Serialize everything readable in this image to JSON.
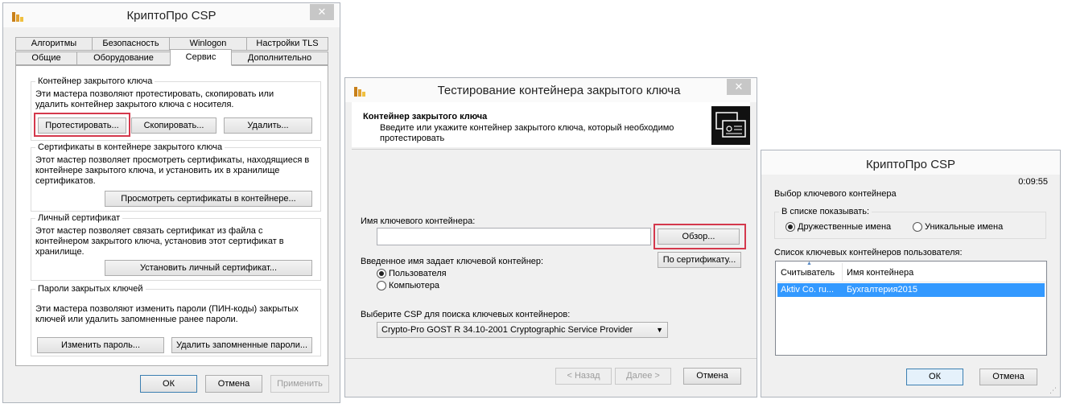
{
  "window1": {
    "title": "КриптоПро CSP",
    "close": "✕",
    "tabs_row1": [
      "Алгоритмы",
      "Безопасность",
      "Winlogon",
      "Настройки TLS"
    ],
    "tabs_row2": [
      "Общие",
      "Оборудование",
      "Сервис",
      "Дополнительно"
    ],
    "group_container": {
      "title": "Контейнер закрытого ключа",
      "desc": "Эти мастера позволяют протестировать, скопировать или удалить контейнер закрытого ключа с носителя.",
      "test_btn": "Протестировать...",
      "copy_btn": "Скопировать...",
      "delete_btn": "Удалить..."
    },
    "group_certs": {
      "title": "Сертификаты в контейнере закрытого ключа",
      "desc": "Этот мастер позволяет просмотреть сертификаты, находящиеся в контейнере закрытого ключа, и установить их в хранилище сертификатов.",
      "view_btn": "Просмотреть сертификаты в контейнере..."
    },
    "group_personal": {
      "title": "Личный сертификат",
      "desc": "Этот мастер позволяет связать сертификат из файла с контейнером закрытого ключа, установив этот сертификат в хранилище.",
      "install_btn": "Установить личный сертификат..."
    },
    "group_passwords": {
      "title": "Пароли закрытых ключей",
      "desc": "Эти мастера позволяют изменить пароли (ПИН-коды) закрытых ключей или удалить запомненные ранее пароли.",
      "change_btn": "Изменить пароль...",
      "delete_saved_btn": "Удалить запомненные пароли..."
    },
    "ok": "ОК",
    "cancel": "Отмена",
    "apply": "Применить"
  },
  "window2": {
    "title": "Тестирование контейнера закрытого ключа",
    "close": "✕",
    "header_title": "Контейнер закрытого ключа",
    "header_desc": "Введите или укажите контейнер закрытого ключа, который необходимо протестировать",
    "container_name_label": "Имя ключевого контейнера:",
    "container_name_value": "",
    "browse_btn": "Обзор...",
    "by_cert_btn": "По сертификату...",
    "name_defines_label": "Введенное имя задает ключевой контейнер:",
    "radio_user": "Пользователя",
    "radio_computer": "Компьютера",
    "csp_label": "Выберите CSP для поиска ключевых контейнеров:",
    "csp_value": "Crypto-Pro GOST R 34.10-2001 Cryptographic Service Provider",
    "back_btn": "< Назад",
    "next_btn": "Далее >",
    "cancel_btn": "Отмена"
  },
  "window3": {
    "title": "КриптоПро CSP",
    "timer": "0:09:55",
    "subtitle": "Выбор ключевого контейнера",
    "show_group": "В списке показывать:",
    "radio_friendly": "Дружественные имена",
    "radio_unique": "Уникальные имена",
    "list_label": "Список ключевых контейнеров пользователя:",
    "columns": [
      "Считыватель",
      "Имя контейнера"
    ],
    "rows": [
      [
        "Aktiv Co. ru...",
        "Бухгалтерия2015"
      ]
    ],
    "ok": "ОК",
    "cancel": "Отмена"
  }
}
